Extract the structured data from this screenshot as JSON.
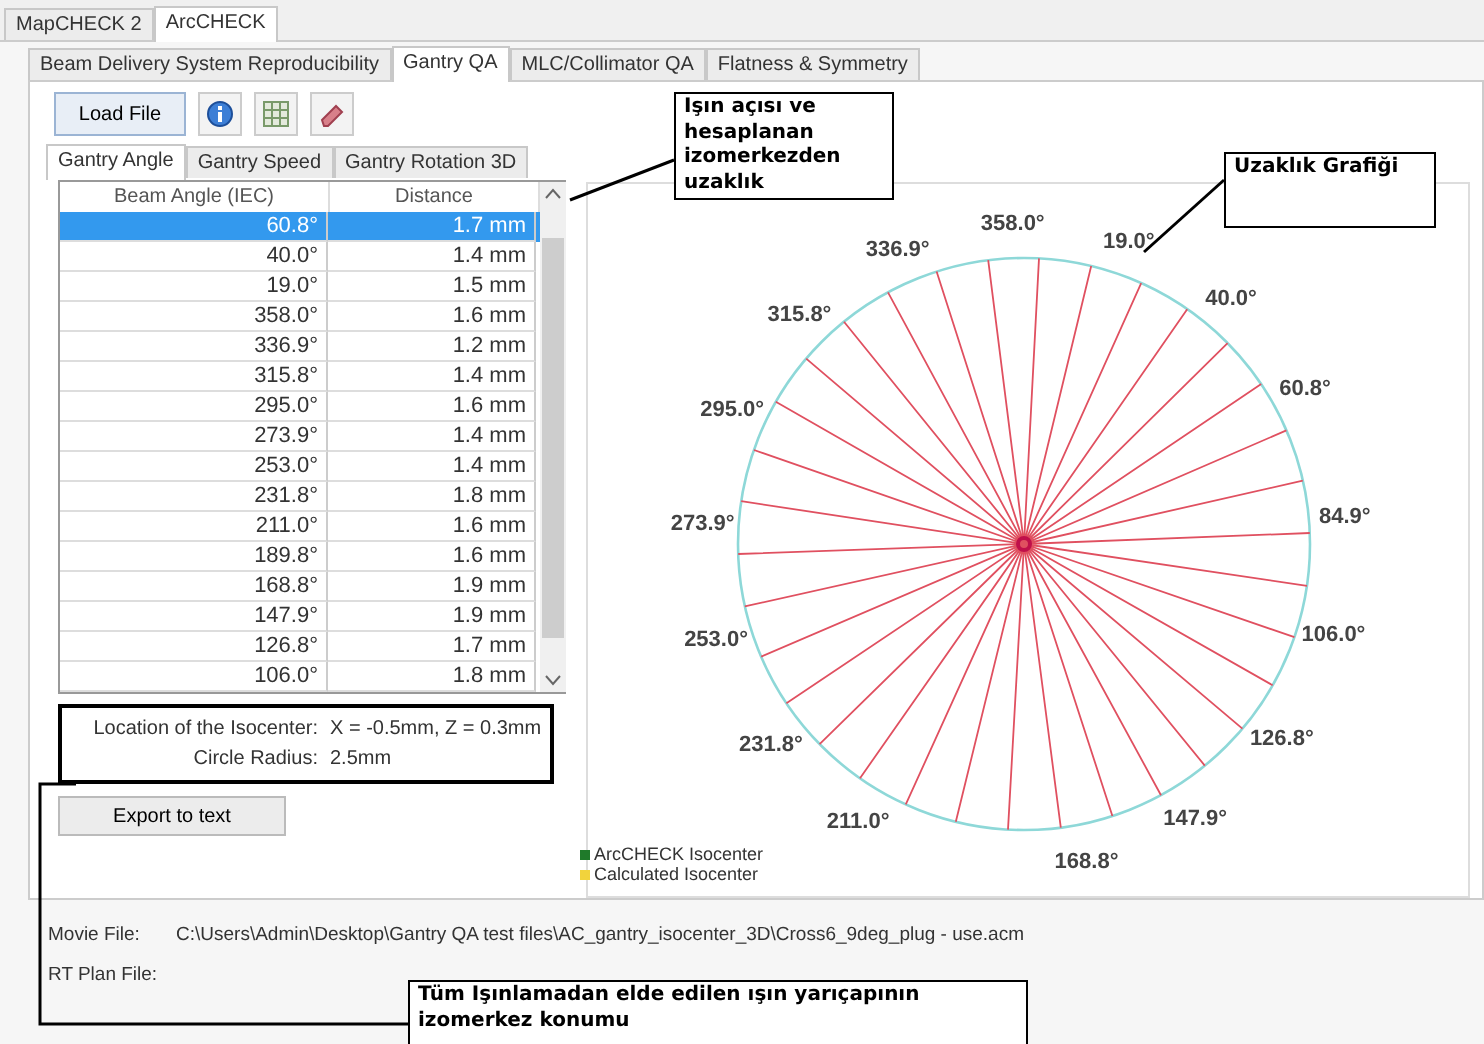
{
  "app_tabs": [
    {
      "label": "MapCHECK 2",
      "selected": false
    },
    {
      "label": "ArcCHECK",
      "selected": true
    }
  ],
  "module_tabs": [
    {
      "label": "Beam Delivery System Reproducibility",
      "selected": false
    },
    {
      "label": "Gantry QA",
      "selected": true
    },
    {
      "label": "MLC/Collimator QA",
      "selected": false
    },
    {
      "label": "Flatness & Symmetry",
      "selected": false
    }
  ],
  "toolbar": {
    "load_button": "Load File"
  },
  "view_tabs": [
    {
      "label": "Gantry Angle",
      "selected": true
    },
    {
      "label": "Gantry Speed",
      "selected": false
    },
    {
      "label": "Gantry Rotation 3D",
      "selected": false
    }
  ],
  "table": {
    "columns": [
      "Beam Angle (IEC)",
      "Distance"
    ],
    "rows": [
      {
        "angle": "60.8°",
        "distance": "1.7 mm",
        "selected": true
      },
      {
        "angle": "40.0°",
        "distance": "1.4 mm",
        "selected": false
      },
      {
        "angle": "19.0°",
        "distance": "1.5 mm",
        "selected": false
      },
      {
        "angle": "358.0°",
        "distance": "1.6 mm",
        "selected": false
      },
      {
        "angle": "336.9°",
        "distance": "1.2 mm",
        "selected": false
      },
      {
        "angle": "315.8°",
        "distance": "1.4 mm",
        "selected": false
      },
      {
        "angle": "295.0°",
        "distance": "1.6 mm",
        "selected": false
      },
      {
        "angle": "273.9°",
        "distance": "1.4 mm",
        "selected": false
      },
      {
        "angle": "253.0°",
        "distance": "1.4 mm",
        "selected": false
      },
      {
        "angle": "231.8°",
        "distance": "1.8 mm",
        "selected": false
      },
      {
        "angle": "211.0°",
        "distance": "1.6 mm",
        "selected": false
      },
      {
        "angle": "189.8°",
        "distance": "1.6 mm",
        "selected": false
      },
      {
        "angle": "168.8°",
        "distance": "1.9 mm",
        "selected": false
      },
      {
        "angle": "147.9°",
        "distance": "1.9 mm",
        "selected": false
      },
      {
        "angle": "126.8°",
        "distance": "1.7 mm",
        "selected": false
      },
      {
        "angle": "106.0°",
        "distance": "1.8 mm",
        "selected": false
      }
    ]
  },
  "isocenter": [
    {
      "label": "Location of the Isocenter:",
      "value": "X = -0.5mm, Z = 0.3mm"
    },
    {
      "label": "Circle Radius:",
      "value": "2.5mm"
    }
  ],
  "export_button": "Export to text",
  "plot": {
    "angle_labels": [
      "358.0°",
      "19.0°",
      "40.0°",
      "60.8°",
      "84.9°",
      "106.0°",
      "126.8°",
      "147.9°",
      "168.8°",
      "211.0°",
      "231.8°",
      "253.0°",
      "273.9°",
      "295.0°",
      "315.8°",
      "336.9°"
    ],
    "legend": [
      {
        "label": "ArcCHECK Isocenter",
        "color": "#1f7a2a"
      },
      {
        "label": "Calculated Isocenter",
        "color": "#f2d33c"
      }
    ]
  },
  "files": [
    {
      "label": "Movie File:",
      "value": "C:\\Users\\Admin\\Desktop\\Gantry QA test files\\AC_gantry_isocenter_3D\\Cross6_9deg_plug - use.acm"
    },
    {
      "label": "RT Plan File:"
    }
  ],
  "annotations": [
    {
      "text": "Işın açısı ve hesaplanan izomerkezden uzaklık"
    },
    {
      "text": "Uzaklık Grafiği"
    },
    {
      "text": "Tüm Işınlamadan elde edilen ışın yarıçapının izomerkez  konumu"
    }
  ]
}
